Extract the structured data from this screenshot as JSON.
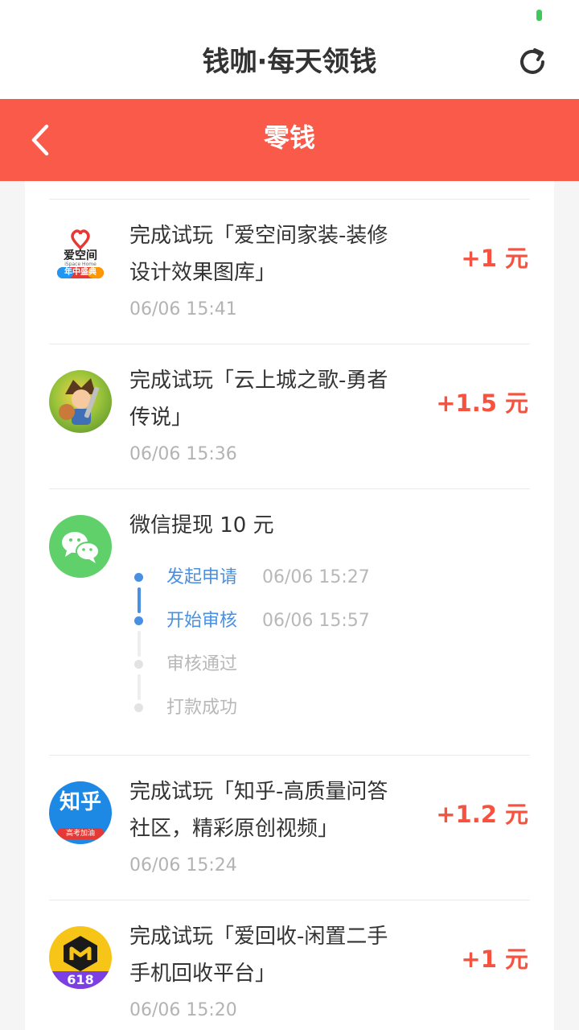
{
  "app": {
    "title": "钱咖·每天领钱"
  },
  "header": {
    "title": "零钱"
  },
  "colors": {
    "accent": "#f95a4a",
    "amount": "#f5523f",
    "link": "#4a90e2"
  },
  "records": [
    {
      "title_line1": "完成试玩「爱空间家装-装修",
      "title_line2": "设计效果图库」",
      "time": "06/06 15:41",
      "amount": "+1 元",
      "icon": "aikongjian-app-icon",
      "icon_text": "爱空间",
      "icon_sub": "iSpace Home",
      "icon_badge": "年中盛典"
    },
    {
      "title_line1": "完成试玩「云上城之歌-勇者",
      "title_line2": "传说」",
      "time": "06/06 15:36",
      "amount": "+1.5 元",
      "icon": "game-character-app-icon"
    },
    {
      "title_line1": "完成试玩「知乎-高质量问答",
      "title_line2": "社区，精彩原创视频」",
      "time": "06/06 15:24",
      "amount": "+1.2 元",
      "icon": "zhihu-app-icon",
      "icon_text": "知乎",
      "icon_badge": "高考加油"
    },
    {
      "title_line1": "完成试玩「爱回收-闲置二手",
      "title_line2": "手机回收平台」",
      "time": "06/06 15:20",
      "amount": "+1 元",
      "icon": "aihuishou-app-icon",
      "icon_text": "618"
    }
  ],
  "withdrawal": {
    "title": "微信提现 10 元",
    "icon": "wechat-icon",
    "steps": [
      {
        "label": "发起申请",
        "time": "06/06 15:27",
        "done": true
      },
      {
        "label": "开始审核",
        "time": "06/06 15:57",
        "done": true
      },
      {
        "label": "审核通过",
        "time": "",
        "done": false
      },
      {
        "label": "打款成功",
        "time": "",
        "done": false
      }
    ]
  }
}
